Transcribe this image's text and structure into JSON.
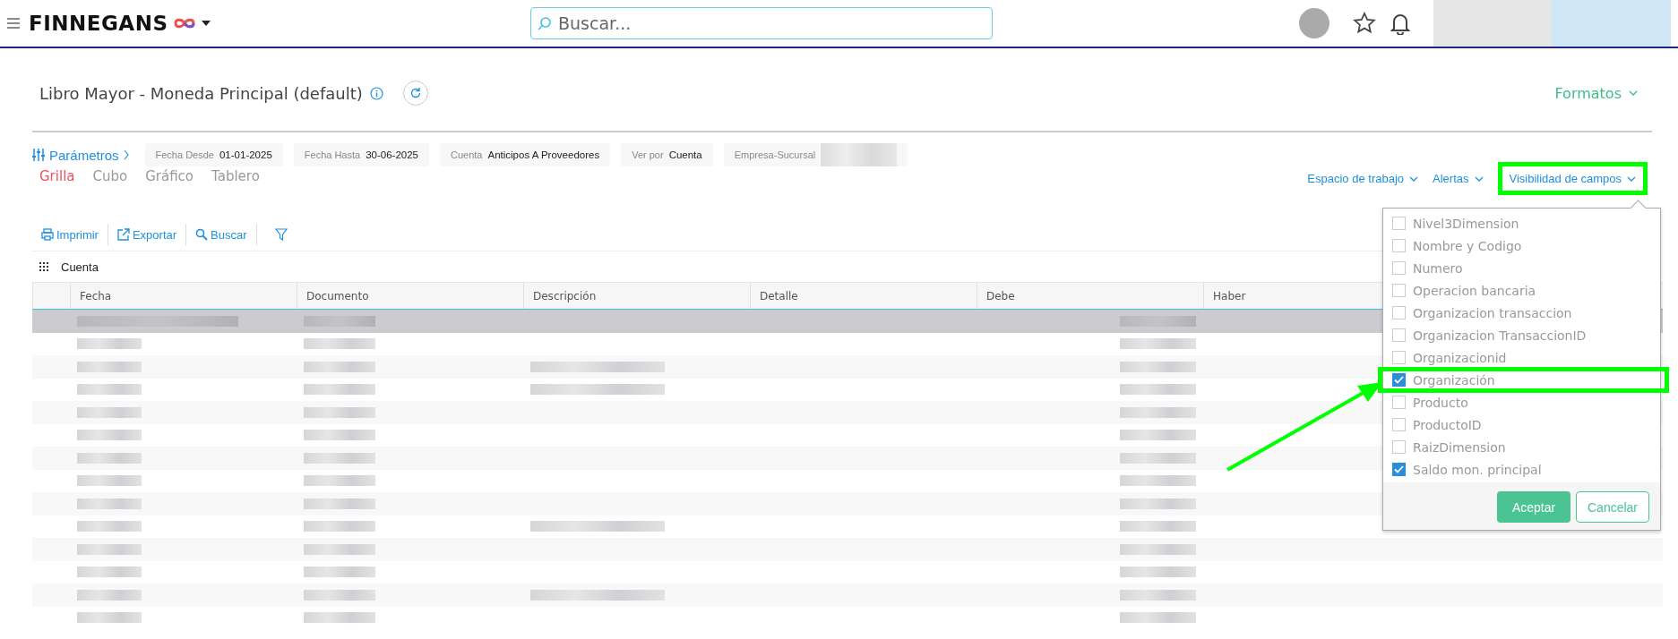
{
  "topbar": {
    "logo": "FINNEGANS",
    "search": {
      "placeholder": "Buscar..."
    }
  },
  "report": {
    "title": "Libro Mayor - Moneda Principal (default)",
    "formats": "Formatos"
  },
  "parameters": {
    "label": "Parámetros",
    "fields": [
      {
        "label": "Fecha Desde",
        "value": "01-01-2025"
      },
      {
        "label": "Fecha Hasta",
        "value": "30-06-2025"
      },
      {
        "label": "Cuenta",
        "value": "Anticipos A Proveedores"
      },
      {
        "label": "Ver por",
        "value": "Cuenta"
      },
      {
        "label": "Empresa-Sucursal"
      }
    ]
  },
  "views": [
    {
      "label": "Grilla",
      "selected": true
    },
    {
      "label": "Cubo",
      "selected": false
    },
    {
      "label": "Gráfico",
      "selected": false
    },
    {
      "label": "Tablero",
      "selected": false
    }
  ],
  "menus": [
    {
      "label": "Espacio de trabajo",
      "highlighted": false
    },
    {
      "label": "Alertas",
      "highlighted": false
    },
    {
      "label": "Visibilidad de campos",
      "highlighted": true
    }
  ],
  "toolbar": [
    {
      "kind": "print",
      "label": "Imprimir"
    },
    {
      "kind": "export",
      "label": "Exportar"
    },
    {
      "kind": "search",
      "label": "Buscar"
    },
    {
      "kind": "filter"
    }
  ],
  "grouping": {
    "label": "Cuenta"
  },
  "table": {
    "columns": [
      "Fecha",
      "Documento",
      "Descripción",
      "Detalle",
      "Debe",
      "Haber"
    ],
    "rows": [
      {
        "selected": true,
        "kind": "plain"
      },
      {
        "selected": false,
        "kind": "plain"
      },
      {
        "selected": false,
        "kind": "with-description"
      },
      {
        "selected": false,
        "kind": "with-description"
      },
      {
        "selected": false,
        "kind": "plain"
      },
      {
        "selected": false,
        "kind": "plain"
      },
      {
        "selected": false,
        "kind": "plain"
      },
      {
        "selected": false,
        "kind": "plain"
      },
      {
        "selected": false,
        "kind": "plain"
      },
      {
        "selected": false,
        "kind": "with-description"
      },
      {
        "selected": false,
        "kind": "plain"
      },
      {
        "selected": false,
        "kind": "plain"
      },
      {
        "selected": false,
        "kind": "with-description"
      },
      {
        "selected": false,
        "kind": "plain"
      }
    ]
  },
  "field_visibility": {
    "items": [
      {
        "label": "Nivel3Dimension",
        "checked": false,
        "highlighted": false
      },
      {
        "label": "Nombre y Codigo",
        "checked": false,
        "highlighted": false
      },
      {
        "label": "Numero",
        "checked": false,
        "highlighted": false
      },
      {
        "label": "Operacion bancaria",
        "checked": false,
        "highlighted": false
      },
      {
        "label": "Organizacion transaccion",
        "checked": false,
        "highlighted": false
      },
      {
        "label": "Organizacion TransaccionID",
        "checked": false,
        "highlighted": false
      },
      {
        "label": "Organizacionid",
        "checked": false,
        "highlighted": false
      },
      {
        "label": "Organización",
        "checked": true,
        "highlighted": true
      },
      {
        "label": "Producto",
        "checked": false,
        "highlighted": false
      },
      {
        "label": "ProductoID",
        "checked": false,
        "highlighted": false
      },
      {
        "label": "RaizDimension",
        "checked": false,
        "highlighted": false
      },
      {
        "label": "Saldo mon. principal",
        "checked": true,
        "highlighted": false
      }
    ],
    "accept": "Aceptar",
    "cancel": "Cancelar"
  }
}
